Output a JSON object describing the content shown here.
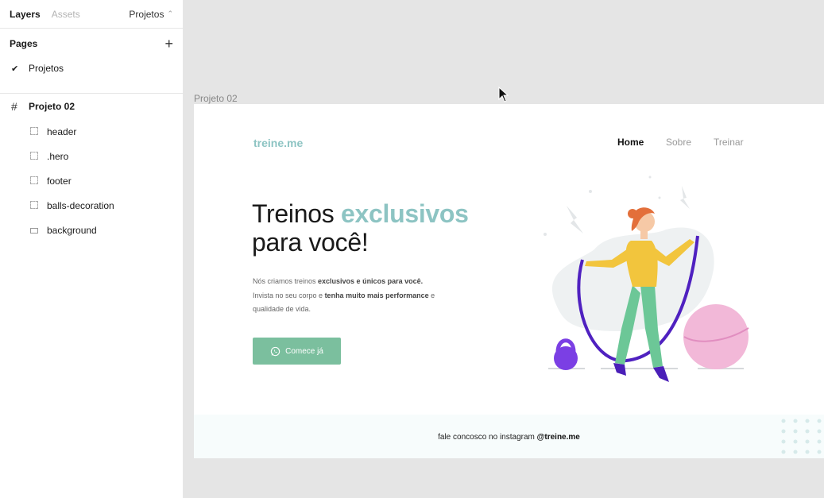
{
  "panel": {
    "tabs": {
      "layers": "Layers",
      "assets": "Assets",
      "page_switch": "Projetos"
    },
    "pages_heading": "Pages",
    "pages": [
      {
        "label": "Projetos",
        "checked": true
      }
    ],
    "frame_name": "Projeto 02",
    "layers": [
      {
        "label": "header",
        "icon": "group-icon"
      },
      {
        "label": ".hero",
        "icon": "group-icon"
      },
      {
        "label": "footer",
        "icon": "group-icon"
      },
      {
        "label": "balls-decoration",
        "icon": "group-icon"
      },
      {
        "label": "background",
        "icon": "rectangle-icon"
      }
    ]
  },
  "canvas": {
    "frame_label": "Projeto 02",
    "site": {
      "logo": "treine.me",
      "nav": {
        "home": "Home",
        "sobre": "Sobre",
        "treinar": "Treinar"
      },
      "hero": {
        "title_start": "Treinos ",
        "title_accent": "exclusivos",
        "title_end": "para você!",
        "p1_a": "Nós criamos treinos ",
        "p1_b": "exclusivos e únicos para você.",
        "p2_a": "Invista no seu corpo e ",
        "p2_b": "tenha muito mais performance",
        "p2_c": " e",
        "p3": "qualidade de vida.",
        "cta": "Comece já"
      },
      "footer": {
        "text": "fale concosco no instagram ",
        "handle": "@treine.me"
      }
    }
  },
  "colors": {
    "accent": "#8dc4c3",
    "button": "#7bbf9e",
    "canvas_bg": "#e5e5e5"
  }
}
